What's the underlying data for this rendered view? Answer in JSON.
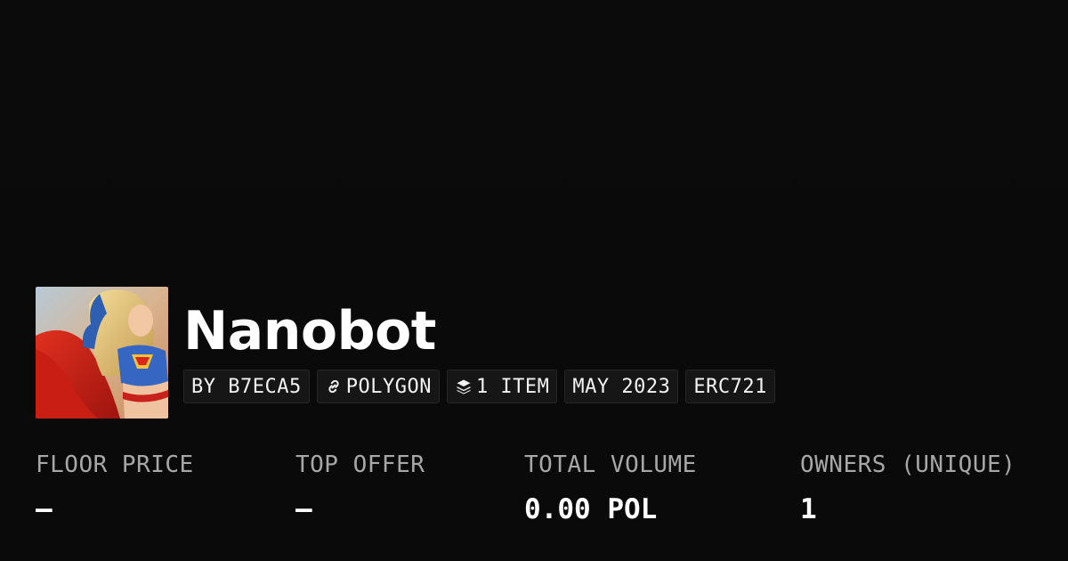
{
  "collection": {
    "name": "Nanobot",
    "avatar_icon": "collection-avatar-image"
  },
  "tags": {
    "creator": "BY B7ECA5",
    "chain": "POLYGON",
    "chain_icon": "link-icon",
    "items": "1 ITEM",
    "items_icon": "layers-icon",
    "created": "MAY 2023",
    "standard": "ERC721"
  },
  "stats": {
    "floor_price": {
      "label": "FLOOR PRICE",
      "value": "–"
    },
    "top_offer": {
      "label": "TOP OFFER",
      "value": "–"
    },
    "total_volume": {
      "label": "TOTAL VOLUME",
      "value": "0.00 POL"
    },
    "owners": {
      "label": "OWNERS (UNIQUE)",
      "value": "1"
    }
  },
  "colors": {
    "background": "#0b0b0b",
    "tag_background": "#161616",
    "label": "#a7a7a7",
    "text": "#ffffff"
  }
}
